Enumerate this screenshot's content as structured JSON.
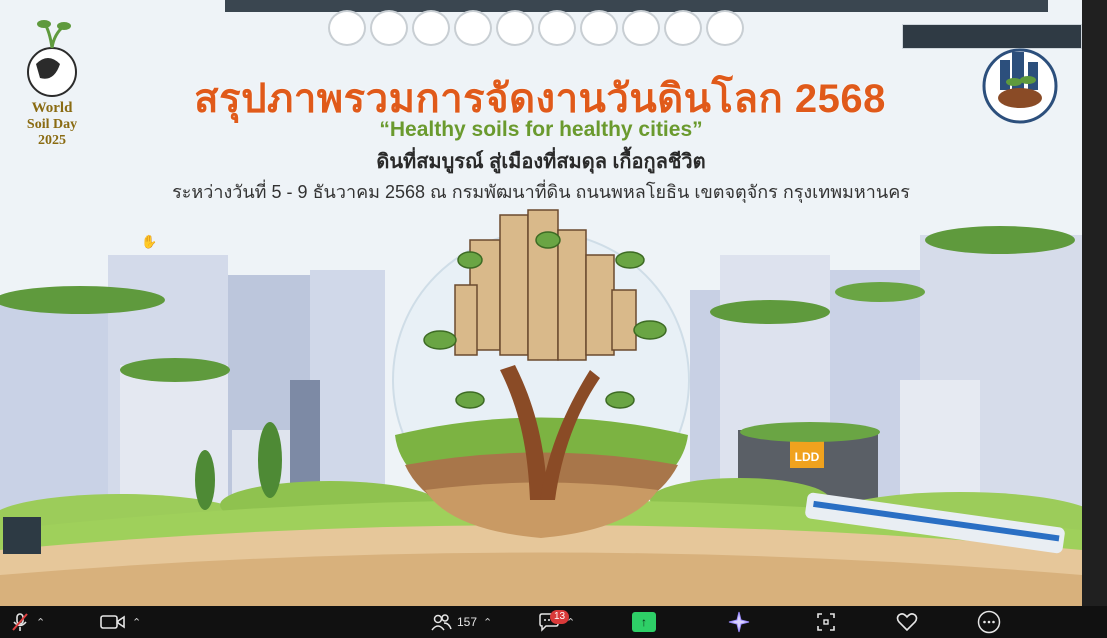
{
  "slide": {
    "title_th": "สรุปภาพรวมการจัดงานวันดินโลก 2568",
    "tagline_en": "“Healthy soils for healthy cities”",
    "subtitle_th": "ดินที่สมบูรณ์ สู่เมืองที่สมดุล เกื้อกูลชีวิต",
    "date_line": "ระหว่างวันที่  5 - 9  ธันวาคม  2568    ณ กรมพัฒนาที่ดิน ถนนพหลโยธิน  เขตจตุจักร  กรุงเทพมหานคร",
    "world_logo": {
      "line1": "World",
      "line2": "Soil Day",
      "line3": "2025"
    },
    "ldd_sign": "LDD",
    "logo_count": 10
  },
  "taskbar": {
    "participants_count": "157",
    "chat_badge": "13",
    "icons": [
      "mic-muted-icon",
      "video-icon",
      "participants-icon",
      "chat-icon",
      "share-icon",
      "sparkle-icon",
      "apps-icon",
      "heart-icon",
      "more-icon"
    ]
  },
  "colors": {
    "title": "#e05a1a",
    "tagline": "#6a9a2e",
    "share_green": "#2ecf67",
    "badge_red": "#d93a3a"
  }
}
